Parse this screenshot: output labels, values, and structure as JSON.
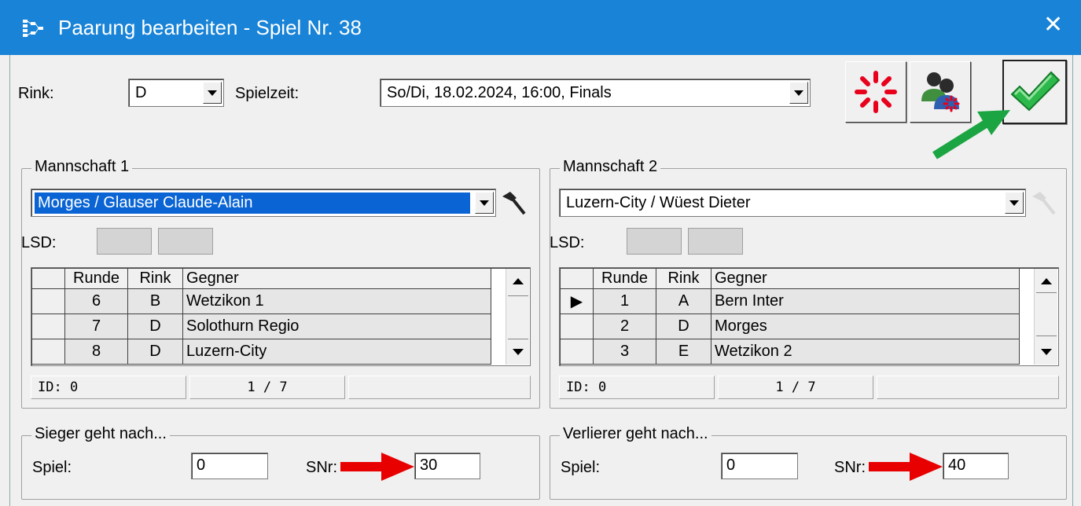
{
  "window": {
    "title": "Paarung bearbeiten - Spiel Nr. 38",
    "close_glyph": "✕"
  },
  "top": {
    "rink_label": "Rink:",
    "rink_value": "D",
    "spielzeit_label": "Spielzeit:",
    "spielzeit_value": "So/Di, 18.02.2024, 16:00, Finals"
  },
  "toolbar": {
    "buttons": [
      {
        "icon": "spinner-reset-icon"
      },
      {
        "icon": "users-swap-icon"
      },
      {
        "icon": "checkmark-ok-icon"
      }
    ],
    "accent_green": "#22a845"
  },
  "team1": {
    "legend": "Mannschaft 1",
    "team_value": "Morges / Glauser Claude-Alain",
    "lsd_label": "LSD:",
    "columns": [
      "Runde",
      "Rink",
      "Gegner"
    ],
    "rows": [
      {
        "indicator": "",
        "runde": "6",
        "rink": "B",
        "gegner": "Wetzikon 1"
      },
      {
        "indicator": "",
        "runde": "7",
        "rink": "D",
        "gegner": "Solothurn Regio"
      },
      {
        "indicator": "",
        "runde": "8",
        "rink": "D",
        "gegner": "Luzern-City"
      }
    ],
    "status_id": "ID: 0",
    "status_pos": "1 / 7"
  },
  "team2": {
    "legend": "Mannschaft 2",
    "team_value": "Luzern-City / Wüest Dieter",
    "lsd_label": "LSD:",
    "columns": [
      "Runde",
      "Rink",
      "Gegner"
    ],
    "rows": [
      {
        "indicator": "▶",
        "runde": "1",
        "rink": "A",
        "gegner": "Bern Inter"
      },
      {
        "indicator": "",
        "runde": "2",
        "rink": "D",
        "gegner": "Morges"
      },
      {
        "indicator": "",
        "runde": "3",
        "rink": "E",
        "gegner": "Wetzikon 2"
      }
    ],
    "status_id": "ID: 0",
    "status_pos": "1 / 7"
  },
  "winner": {
    "legend": "Sieger geht nach...",
    "spiel_label": "Spiel:",
    "spiel_value": "0",
    "snr_label": "SNr:",
    "snr_value": "30"
  },
  "loser": {
    "legend": "Verlierer geht nach...",
    "spiel_label": "Spiel:",
    "spiel_value": "0",
    "snr_label": "SNr:",
    "snr_value": "40"
  },
  "annotation_colors": {
    "red_arrow": "#e80000",
    "green_arrow": "#1aa542"
  }
}
